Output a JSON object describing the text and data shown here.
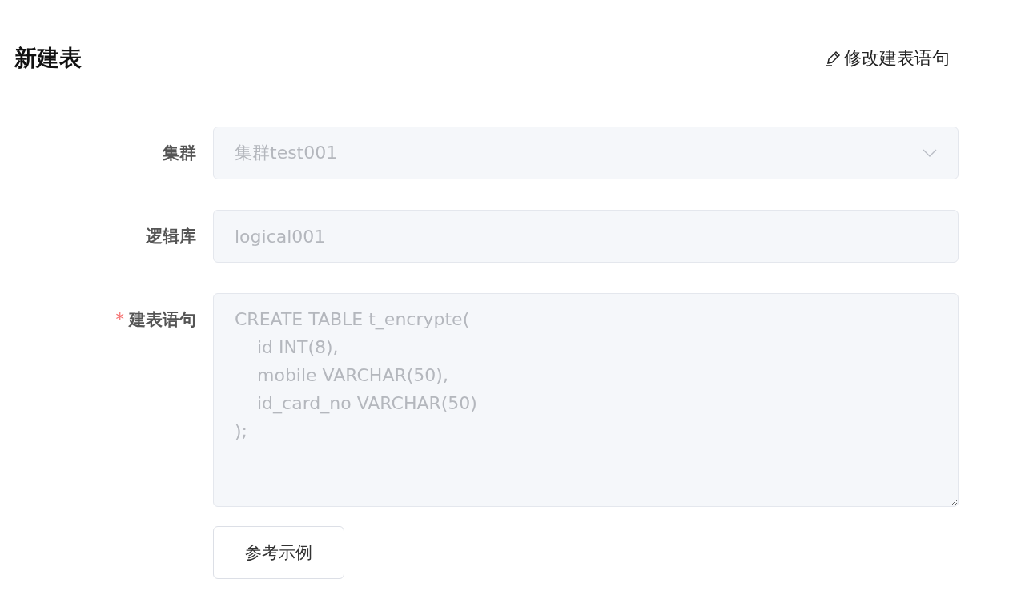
{
  "title": "新建表",
  "edit_link": {
    "label": "修改建表语句"
  },
  "required_mark": "*",
  "fields": [
    {
      "kind": "select",
      "label": "集群",
      "required": false,
      "disabled": true,
      "value": "集群test001"
    },
    {
      "kind": "input",
      "label": "逻辑库",
      "required": false,
      "disabled": true,
      "value": "logical001"
    },
    {
      "kind": "textarea",
      "label": "建表语句",
      "required": true,
      "disabled": true,
      "value": "CREATE TABLE t_encrypte(\n    id INT(8),\n    mobile VARCHAR(50),\n    id_card_no VARCHAR(50)\n);"
    }
  ],
  "example_button": {
    "label": "参考示例"
  }
}
